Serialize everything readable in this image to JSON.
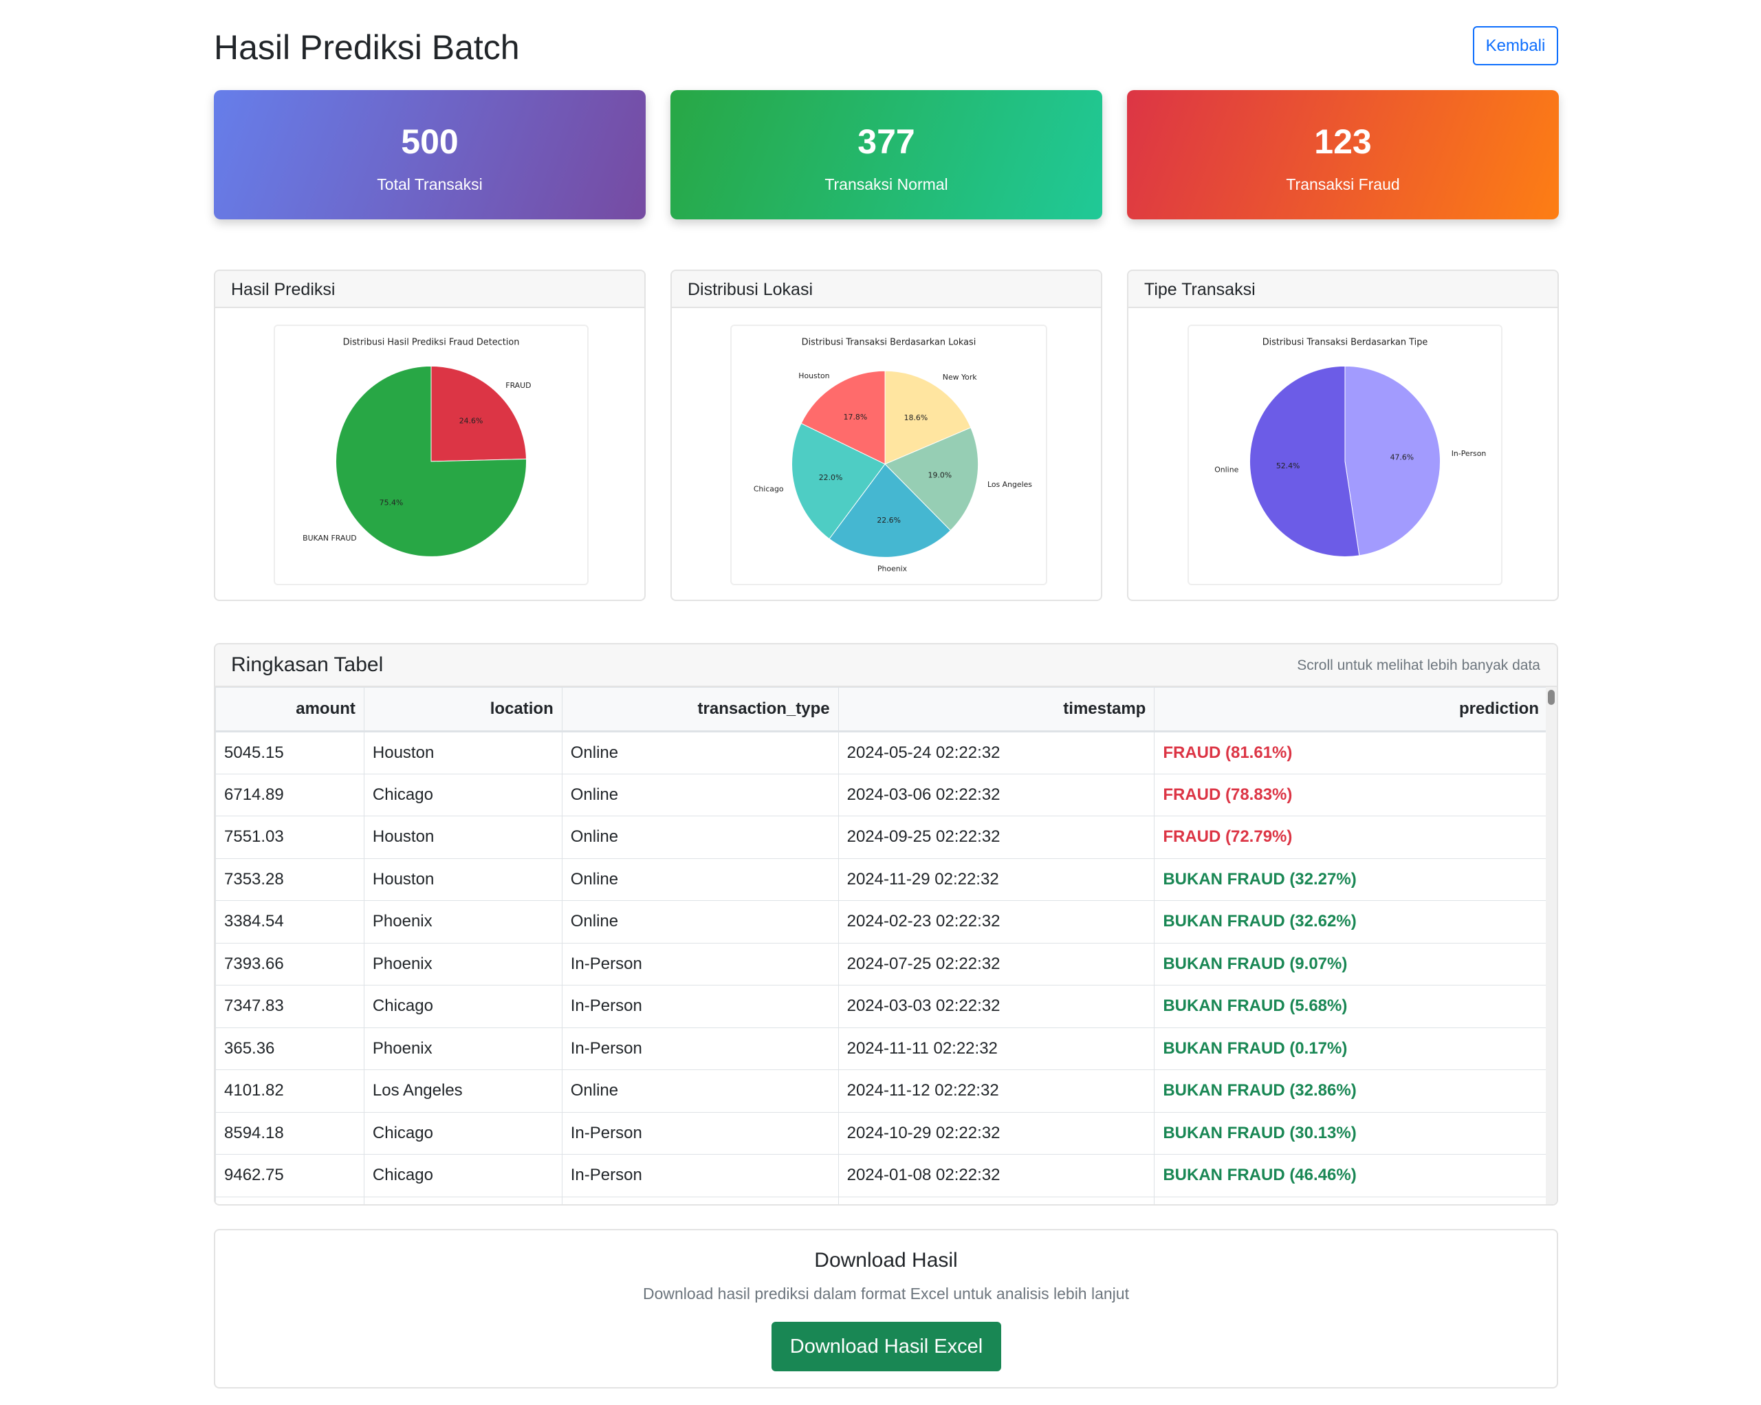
{
  "header": {
    "title": "Hasil Prediksi Batch",
    "back_label": "Kembali"
  },
  "stats": {
    "total": {
      "value": "500",
      "label": "Total Transaksi"
    },
    "normal": {
      "value": "377",
      "label": "Transaksi Normal"
    },
    "fraud": {
      "value": "123",
      "label": "Transaksi Fraud"
    }
  },
  "charts": {
    "prediction": {
      "card_title": "Hasil Prediksi",
      "colors": [
        "#dc3545",
        "#28a745"
      ]
    },
    "location": {
      "card_title": "Distribusi Lokasi",
      "colors": [
        "#ffe5a0",
        "#96ceb4",
        "#45b7d1",
        "#4ecdc4",
        "#ff6b6b"
      ]
    },
    "type": {
      "card_title": "Tipe Transaksi",
      "colors": [
        "#a29bfe",
        "#6c5ce7"
      ]
    }
  },
  "chart_data": [
    {
      "type": "pie",
      "title": "Distribusi Hasil Prediksi Fraud Detection",
      "categories": [
        "FRAUD",
        "BUKAN FRAUD"
      ],
      "values": [
        24.6,
        75.4
      ],
      "value_labels": [
        "24.6%",
        "75.4%"
      ]
    },
    {
      "type": "pie",
      "title": "Distribusi Transaksi Berdasarkan Lokasi",
      "categories": [
        "New York",
        "Los Angeles",
        "Phoenix",
        "Chicago",
        "Houston"
      ],
      "values": [
        18.6,
        19.0,
        22.6,
        22.0,
        17.8
      ],
      "value_labels": [
        "18.6%",
        "19.0%",
        "22.6%",
        "22.0%",
        "17.8%"
      ]
    },
    {
      "type": "pie",
      "title": "Distribusi Transaksi Berdasarkan Tipe",
      "categories": [
        "In-Person",
        "Online"
      ],
      "values": [
        47.6,
        52.4
      ],
      "value_labels": [
        "47.6%",
        "52.4%"
      ]
    }
  ],
  "table": {
    "title": "Ringkasan Tabel",
    "hint": "Scroll untuk melihat lebih banyak data",
    "columns": [
      "amount",
      "location",
      "transaction_type",
      "timestamp",
      "prediction"
    ],
    "rows": [
      [
        "5045.15",
        "Houston",
        "Online",
        "2024-05-24 02:22:32",
        "FRAUD (81.61%)"
      ],
      [
        "6714.89",
        "Chicago",
        "Online",
        "2024-03-06 02:22:32",
        "FRAUD (78.83%)"
      ],
      [
        "7551.03",
        "Houston",
        "Online",
        "2024-09-25 02:22:32",
        "FRAUD (72.79%)"
      ],
      [
        "7353.28",
        "Houston",
        "Online",
        "2024-11-29 02:22:32",
        "BUKAN FRAUD (32.27%)"
      ],
      [
        "3384.54",
        "Phoenix",
        "Online",
        "2024-02-23 02:22:32",
        "BUKAN FRAUD (32.62%)"
      ],
      [
        "7393.66",
        "Phoenix",
        "In-Person",
        "2024-07-25 02:22:32",
        "BUKAN FRAUD (9.07%)"
      ],
      [
        "7347.83",
        "Chicago",
        "In-Person",
        "2024-03-03 02:22:32",
        "BUKAN FRAUD (5.68%)"
      ],
      [
        "365.36",
        "Phoenix",
        "In-Person",
        "2024-11-11 02:22:32",
        "BUKAN FRAUD (0.17%)"
      ],
      [
        "4101.82",
        "Los Angeles",
        "Online",
        "2024-11-12 02:22:32",
        "BUKAN FRAUD (32.86%)"
      ],
      [
        "8594.18",
        "Chicago",
        "In-Person",
        "2024-10-29 02:22:32",
        "BUKAN FRAUD (30.13%)"
      ],
      [
        "9462.75",
        "Chicago",
        "In-Person",
        "2024-01-08 02:22:32",
        "BUKAN FRAUD (46.46%)"
      ],
      [
        "",
        "",
        "",
        "",
        ""
      ]
    ]
  },
  "download": {
    "title": "Download Hasil",
    "description": "Download hasil prediksi dalam format Excel untuk analisis lebih lanjut",
    "button_label": "Download Hasil Excel"
  }
}
